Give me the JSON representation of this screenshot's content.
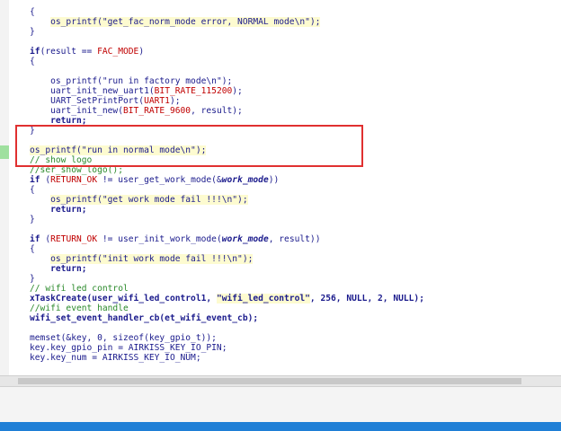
{
  "code": {
    "line_0": "                                                        ",
    "line_1a": "{",
    "line_2": "os_printf(\"get_fac_norm_mode error, NORMAL mode\\n\");",
    "line_3a": "}",
    "if_kw": "if",
    "line_5_cond_a": "(result == ",
    "line_5_macro": "FAC_MODE",
    "line_5_cond_b": ")",
    "line_6": "{",
    "line_7": "os_printf(\"run in factory mode\\n\");",
    "line_8a": "uart_init_new_uart1(",
    "line_8m": "BIT_RATE_115200",
    "line_8b": ");",
    "line_9a": "UART_SetPrintPort(",
    "line_9m": "UART1",
    "line_9b": ");",
    "line_10a": "uart_init_new(",
    "line_10m": "BIT_RATE_9600",
    "line_10b": ", result);",
    "return_kw": "return;",
    "line_12": "}",
    "line_14": "os_printf(\"run in normal mode\\n\");",
    "line_15": "// show logo",
    "line_16": "//ser_show_logo();",
    "line_17a": "if (",
    "line_17m": "RETURN_OK",
    "line_17b": " != user_get_work_mode(&",
    "line_17i": "work_mode",
    "line_17c": "))",
    "line_18": "{",
    "line_19": "os_printf(\"get work mode fail !!!\\n\");",
    "line_21": "}",
    "line_23a": "if (",
    "line_23m": "RETURN_OK",
    "line_23b": " != user_init_work_mode(",
    "line_23i": "work_mode",
    "line_23c": ", result))",
    "line_24": "{",
    "line_25": "os_printf(\"init work mode fail !!!\\n\");",
    "line_27": "}",
    "line_28": "// wifi led control",
    "line_29a": "xTaskCreate(user_wifi_led_control1, ",
    "line_29s": "\"wifi_led_control\"",
    "line_29b": ", 256, NULL, 2, NULL);",
    "line_30": "//wifi event handle",
    "line_31": "wifi_set_event_handler_cb(et_wifi_event_cb);",
    "line_33": "memset(&key, 0, sizeof(key_gpio_t));",
    "line_34": "key.key_gpio_pin = AIRKISS_KEY_IO_PIN;",
    "line_35": "key.key_num = AIRKISS_KEY_IO_NUM;"
  }
}
